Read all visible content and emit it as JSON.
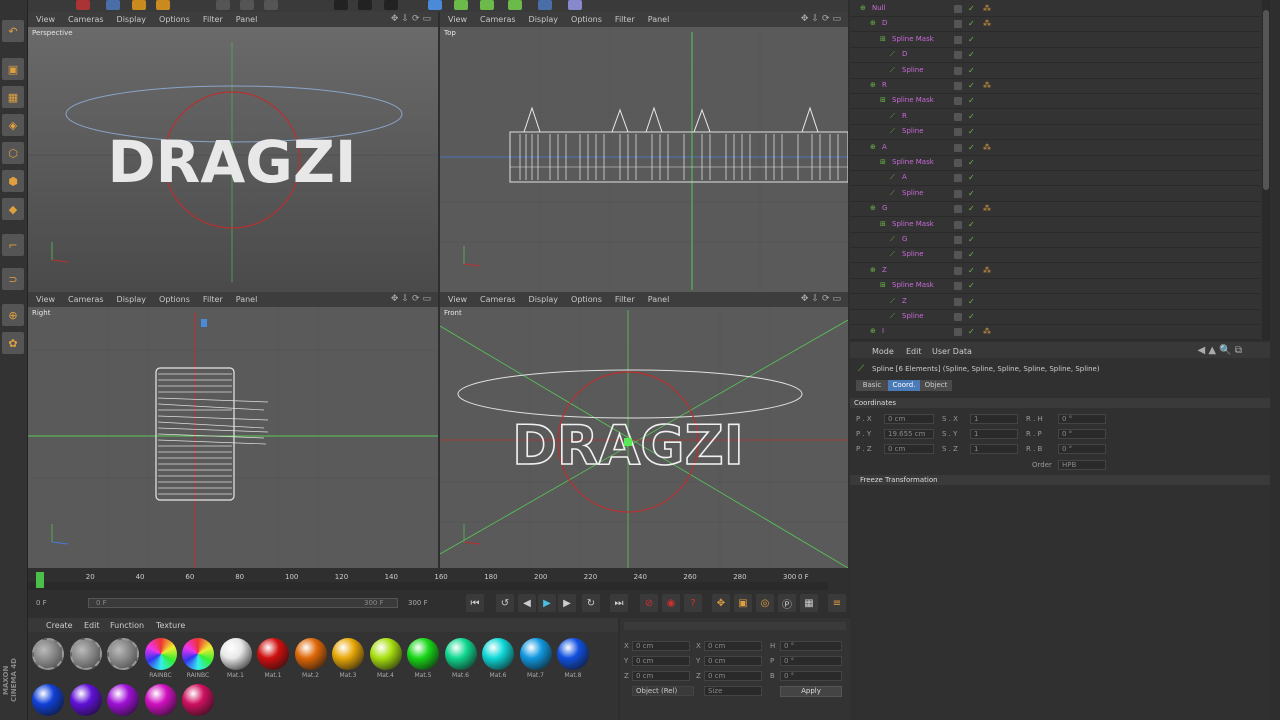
{
  "brand": "MAXON CINEMA 4D",
  "viewport_menu": [
    "View",
    "Cameras",
    "Display",
    "Options",
    "Filter",
    "Panel"
  ],
  "viewports": {
    "perspective": {
      "name": "Perspective"
    },
    "top": {
      "name": "Top"
    },
    "right": {
      "name": "Right"
    },
    "front": {
      "name": "Front"
    }
  },
  "scene_text": "DRAGZI",
  "object_manager": {
    "rows": [
      {
        "name": "Null",
        "color": "#c86ad8",
        "indent": 0
      },
      {
        "name": "D",
        "color": "#c86ad8",
        "indent": 1
      },
      {
        "name": "Spline Mask",
        "color": "#c86ad8",
        "indent": 2
      },
      {
        "name": "D",
        "color": "#c86ad8",
        "indent": 3
      },
      {
        "name": "Spline",
        "color": "#c86ad8",
        "indent": 3
      },
      {
        "name": "R",
        "color": "#c86ad8",
        "indent": 1
      },
      {
        "name": "Spline Mask",
        "color": "#c86ad8",
        "indent": 2
      },
      {
        "name": "R",
        "color": "#c86ad8",
        "indent": 3
      },
      {
        "name": "Spline",
        "color": "#c86ad8",
        "indent": 3
      },
      {
        "name": "A",
        "color": "#c86ad8",
        "indent": 1
      },
      {
        "name": "Spline Mask",
        "color": "#c86ad8",
        "indent": 2
      },
      {
        "name": "A",
        "color": "#c86ad8",
        "indent": 3
      },
      {
        "name": "Spline",
        "color": "#c86ad8",
        "indent": 3
      },
      {
        "name": "G",
        "color": "#c86ad8",
        "indent": 1
      },
      {
        "name": "Spline Mask",
        "color": "#c86ad8",
        "indent": 2
      },
      {
        "name": "G",
        "color": "#c86ad8",
        "indent": 3
      },
      {
        "name": "Spline",
        "color": "#c86ad8",
        "indent": 3
      },
      {
        "name": "Z",
        "color": "#c86ad8",
        "indent": 1
      },
      {
        "name": "Spline Mask",
        "color": "#c86ad8",
        "indent": 2
      },
      {
        "name": "Z",
        "color": "#c86ad8",
        "indent": 3
      },
      {
        "name": "Spline",
        "color": "#c86ad8",
        "indent": 3
      },
      {
        "name": "I",
        "color": "#c86ad8",
        "indent": 1
      }
    ]
  },
  "attributes": {
    "menu": [
      "Mode",
      "Edit",
      "User Data"
    ],
    "title": "Spline [6 Elements] (Spline, Spline, Spline, Spline, Spline, Spline)",
    "tabs": [
      "Basic",
      "Coord.",
      "Object"
    ],
    "active_tab": "Coord.",
    "section": "Coordinates",
    "pos": {
      "x": "0 cm",
      "y": "19.655 cm",
      "z": "0 cm"
    },
    "pos_labels": [
      "P . X",
      "P . Y",
      "P . Z"
    ],
    "scale_labels": [
      "S . X",
      "S . Y",
      "S . Z"
    ],
    "scale": {
      "x": "1",
      "y": "1",
      "z": "1"
    },
    "rot_labels": [
      "R . H",
      "R . P",
      "R . B"
    ],
    "rot": {
      "h": "0 °",
      "p": "0 °",
      "b": "0 °"
    },
    "order_label": "Order",
    "order_value": "HPB",
    "freeze": "Freeze Transformation"
  },
  "timeline": {
    "ticks": [
      "0",
      "20",
      "40",
      "60",
      "80",
      "100",
      "120",
      "140",
      "160",
      "180",
      "200",
      "220",
      "240",
      "260",
      "280",
      "300"
    ],
    "current": "0 F",
    "start": "0 F",
    "min_field": "0 F",
    "max_field": "300 F",
    "end": "300 F"
  },
  "material_menu": [
    "Create",
    "Edit",
    "Function",
    "Texture"
  ],
  "materials": [
    {
      "label": "",
      "color": "#888",
      "kind": "noise"
    },
    {
      "label": "",
      "color": "#888",
      "kind": "noise"
    },
    {
      "label": "",
      "color": "#888",
      "kind": "noise"
    },
    {
      "label": "RAINBC",
      "color": "#cc4",
      "kind": "rainbow"
    },
    {
      "label": "RAINBC",
      "color": "#cc4",
      "kind": "rainbow"
    },
    {
      "label": "Mat.1",
      "color": "#e8e8e8",
      "kind": "ball"
    },
    {
      "label": "Mat.1",
      "color": "#d01010",
      "kind": "ball"
    },
    {
      "label": "Mat.2",
      "color": "#e06808",
      "kind": "ball"
    },
    {
      "label": "Mat.3",
      "color": "#e8a808",
      "kind": "ball"
    },
    {
      "label": "Mat.4",
      "color": "#a8e010",
      "kind": "ball"
    },
    {
      "label": "Mat.5",
      "color": "#18d818",
      "kind": "ball"
    },
    {
      "label": "Mat.6",
      "color": "#10d890",
      "kind": "ball"
    },
    {
      "label": "Mat.6",
      "color": "#10d8d8",
      "kind": "ball"
    },
    {
      "label": "Mat.7",
      "color": "#1098e0",
      "kind": "ball"
    },
    {
      "label": "Mat.8",
      "color": "#1050e0",
      "kind": "ball"
    }
  ],
  "materials_row2": [
    {
      "color": "#1040d8"
    },
    {
      "color": "#6010d8"
    },
    {
      "color": "#a010d8"
    },
    {
      "color": "#d010c0"
    },
    {
      "color": "#d01060"
    }
  ],
  "coord_manager": {
    "labels": [
      "X",
      "Y",
      "Z"
    ],
    "pos": [
      "0 cm",
      "0 cm",
      "0 cm"
    ],
    "size": [
      "0 cm",
      "0 cm",
      "0 cm"
    ],
    "rot_labels": [
      "H",
      "P",
      "B"
    ],
    "rot": [
      "0 °",
      "0 °",
      "0 °"
    ],
    "mode": "Object (Rel)",
    "size_mode": "Size",
    "apply": "Apply"
  }
}
